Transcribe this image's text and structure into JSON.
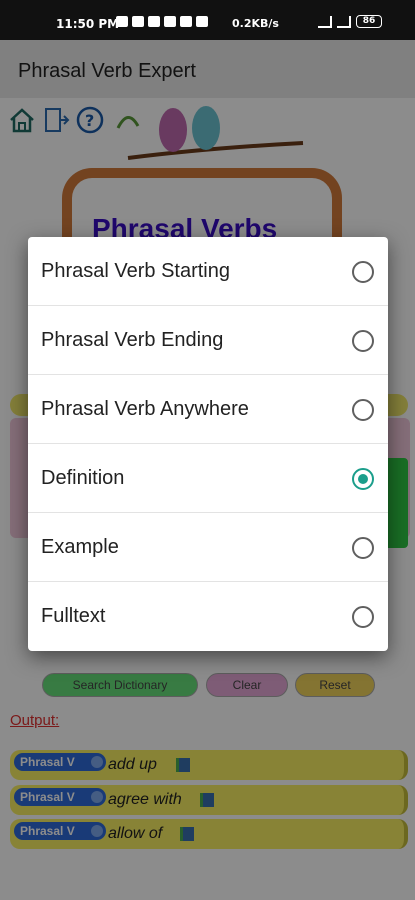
{
  "status": {
    "time": "11:50 PM",
    "network_speed": "0.2KB/s",
    "battery": "86"
  },
  "app": {
    "title": "Phrasal Verb Expert",
    "banner_title": "Phrasal Verbs"
  },
  "dialog": {
    "options": [
      {
        "label": "Phrasal Verb Starting",
        "selected": false
      },
      {
        "label": "Phrasal Verb Ending",
        "selected": false
      },
      {
        "label": "Phrasal Verb Anywhere",
        "selected": false
      },
      {
        "label": "Definition",
        "selected": true
      },
      {
        "label": "Example",
        "selected": false
      },
      {
        "label": "Fulltext",
        "selected": false
      }
    ]
  },
  "buttons": {
    "search": "Search Dictionary",
    "clear": "Clear",
    "reset": "Reset"
  },
  "output": {
    "label": "Output:",
    "results": [
      {
        "tag": "Phrasal V",
        "text": "add up"
      },
      {
        "tag": "Phrasal V",
        "text": "agree with"
      },
      {
        "tag": "Phrasal V",
        "text": "allow of"
      }
    ]
  },
  "colors": {
    "accent_radio": "#1b9e8b",
    "search_button": "#66e07a",
    "clear_button": "#e5a8d8",
    "reset_button": "#f1d35c",
    "result_row": "#f8ef63",
    "tag_pill": "#2f6bd9"
  }
}
